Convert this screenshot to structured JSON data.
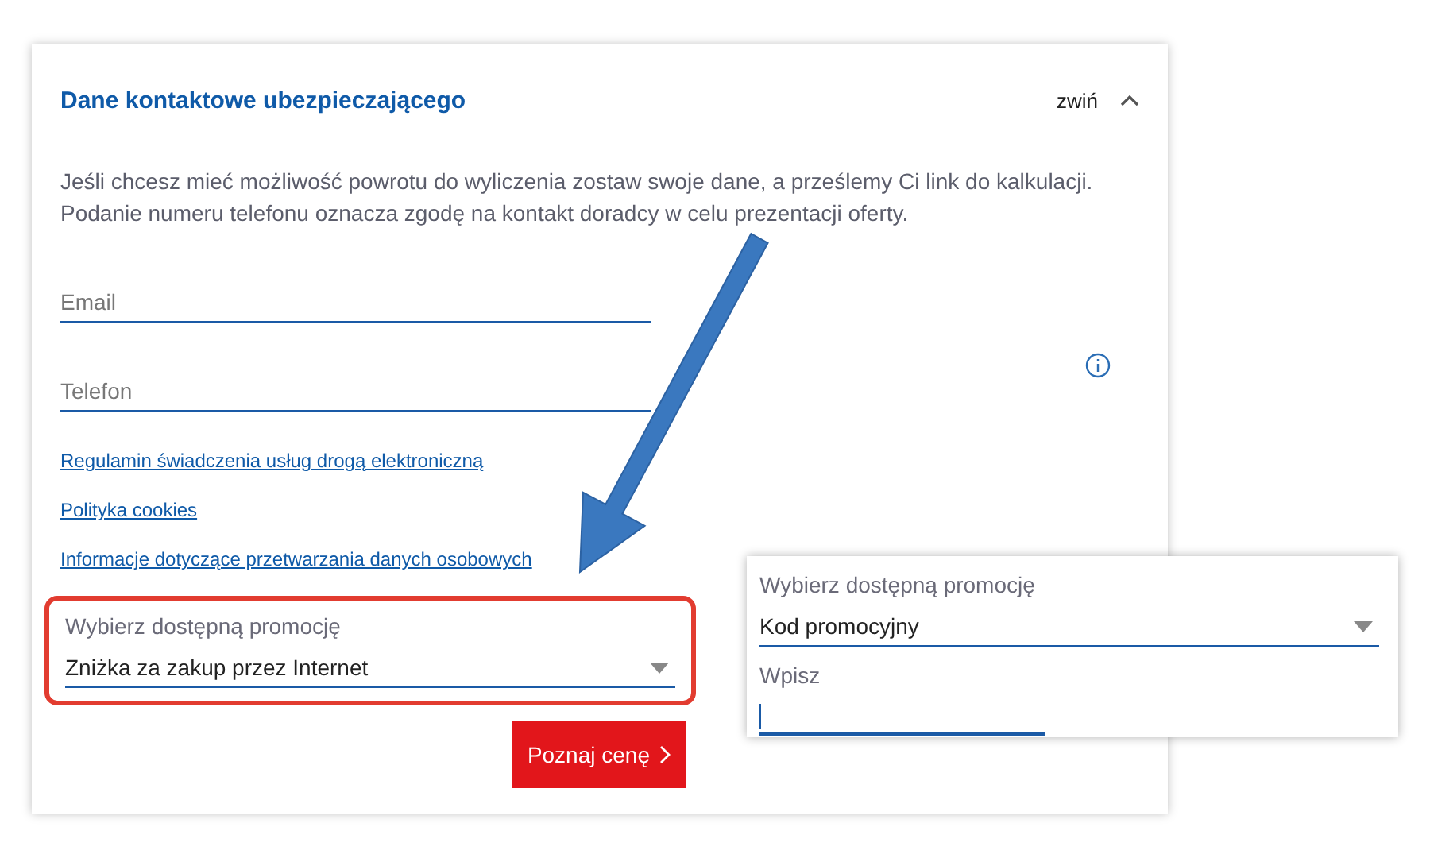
{
  "section": {
    "title": "Dane kontaktowe ubezpieczającego",
    "collapse_label": "zwiń",
    "expanded": true
  },
  "description": [
    "Jeśli chcesz mieć możliwość powrotu do wyliczenia zostaw swoje dane, a prześlemy Ci link do kalkulacji.",
    "Podanie numeru telefonu oznacza zgodę na kontakt doradcy w celu prezentacji oferty."
  ],
  "fields": [
    {
      "placeholder": "Email",
      "info": false
    },
    {
      "placeholder": "Telefon",
      "info": true
    }
  ],
  "links": [
    "Regulamin świadczenia usług drogą elektroniczną",
    "Polityka cookies",
    "Informacje dotyczące przetwarzania danych osobowych"
  ],
  "promo_select": {
    "label": "Wybierz dostępną promocję",
    "value": "Zniżka za zakup przez Internet",
    "highlighted": true
  },
  "submit_button": "Poznaj cenę",
  "inset": {
    "select": {
      "label": "Wybierz dostępną promocję",
      "value": "Kod promocyjny"
    },
    "code_field": {
      "label": "Wpisz",
      "focused": true
    }
  }
}
